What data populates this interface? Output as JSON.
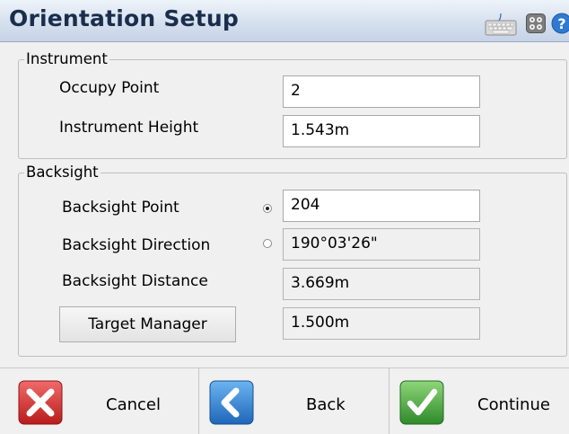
{
  "window": {
    "title": "Orientation Setup"
  },
  "toolbar_icons": [
    "keyboard-icon",
    "settings-grid-icon",
    "help-icon"
  ],
  "instrument": {
    "legend": "Instrument",
    "occupy_point_label": "Occupy Point",
    "occupy_point_value": "2",
    "instrument_height_label": "Instrument Height",
    "instrument_height_value": "1.543m"
  },
  "backsight": {
    "legend": "Backsight",
    "point_label": "Backsight Point",
    "point_value": "204",
    "direction_label": "Backsight Direction",
    "direction_value": "190°03'26\"",
    "distance_label": "Backsight Distance",
    "distance_value": "3.669m",
    "target_manager_label": "Target Manager",
    "target_height_value": "1.500m",
    "selected_mode": "point"
  },
  "buttons": {
    "cancel": "Cancel",
    "back": "Back",
    "continue": "Continue"
  },
  "colors": {
    "title_text": "#1a2e4c",
    "cancel_red": "#d32a2a",
    "back_blue": "#2a7fd4",
    "continue_green": "#3fa03a"
  }
}
